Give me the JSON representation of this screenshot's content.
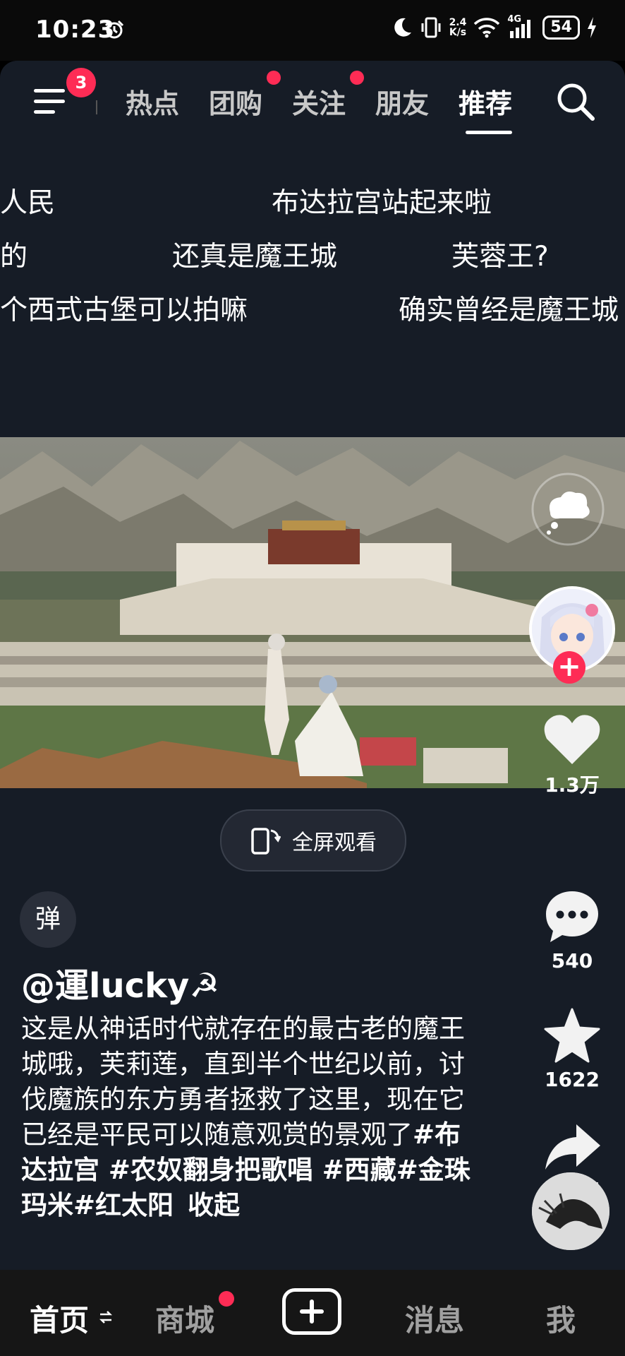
{
  "status_bar": {
    "time": "10:23",
    "net_speed_value": "2.4",
    "net_speed_unit": "K/s",
    "signal_label": "4G",
    "battery": "54"
  },
  "top_nav": {
    "menu_badge": "3",
    "tabs": [
      {
        "label": "热点"
      },
      {
        "label": "团购"
      },
      {
        "label": "关注"
      },
      {
        "label": "朋友"
      },
      {
        "label": "推荐"
      }
    ]
  },
  "danmaku": [
    "人民",
    "布达拉宫站起来啦",
    "的",
    "还真是魔王城",
    "芙蓉王?",
    "个西式古堡可以拍嘛",
    "确实曾经是魔王城"
  ],
  "video": {
    "fullscreen_label": "全屏观看"
  },
  "danmu_toggle_label": "弹",
  "post": {
    "username": "@運lucky☭",
    "caption_text": "这是从神话时代就存在的最古老的魔王城哦，芙莉莲，直到半个世纪以前，讨伐魔族的东方勇者拯救了这里，现在它已经是平民可以随意观赏的景观了",
    "hashtags": "#布达拉宫 #农奴翻身把歌唱 #西藏#金珠玛米#红太阳",
    "collapse_label": "收起"
  },
  "actions": {
    "likes": "1.3万",
    "comments": "540",
    "favorites": "1622",
    "shares": "1447"
  },
  "bottom_nav": {
    "home": "首页",
    "mall": "商城",
    "messages": "消息",
    "me": "我"
  },
  "colors": {
    "accent": "#fe2c55",
    "background": "#161c26",
    "bottom_bar": "#161616"
  }
}
